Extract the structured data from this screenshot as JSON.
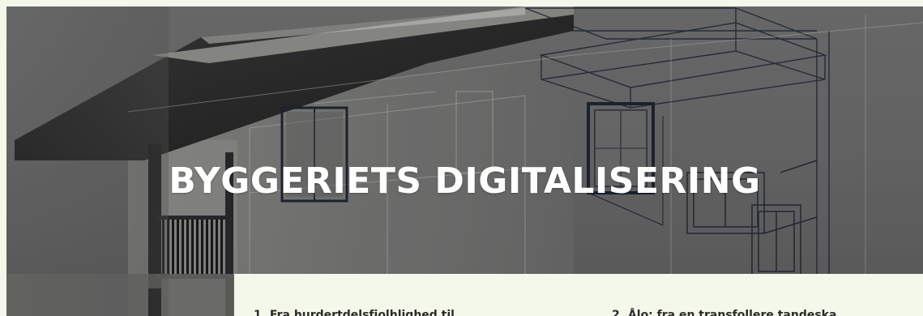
{
  "hero": {
    "title": "BYGGERIETS DIGITALISERING",
    "image_alt_icon": "building-wireframe-illustration"
  },
  "content": {
    "toc_items": [
      "1. Fra hurdertdelsfjolhlighed til ...",
      "2. Ålo: fra en transfollere tandeska..."
    ]
  },
  "colors": {
    "page_background": "#f3f8ea",
    "hero_overlay": "#6a6a6a",
    "title_text": "#ffffff",
    "roof_dark": "#2a2a2a",
    "wireframe": "#1f2433"
  }
}
